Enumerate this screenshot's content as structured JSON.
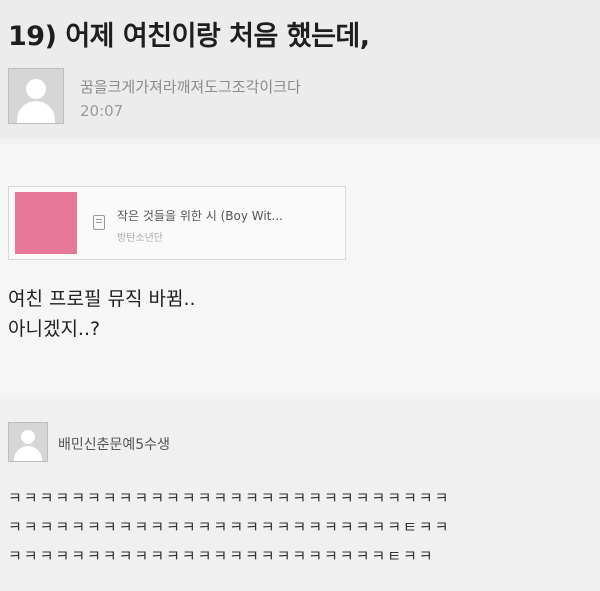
{
  "post": {
    "title": "19) 어제 여친이랑 처음 했는데,",
    "author": "꿈을크게가져라깨져도그조각이크다",
    "time": "20:07",
    "music": {
      "title": "작은 것들을 위한 시 (Boy Wit...",
      "artist": "방탄소년단",
      "album_color": "#e8789a"
    },
    "body_lines": [
      "여친 프로필 뮤직 바뀜..",
      "아니겠지..?"
    ]
  },
  "comment": {
    "author": "배민신춘문예5수생",
    "lines": [
      "ㅋㅋㅋㅋㅋㅋㅋㅋㅋㅋㅋㅋㅋㅋㅋㅋㅋㅋㅋㅋㅋㅋㅋㅋㅋㅋㅋㅋ",
      "ㅋㅋㅋㅋㅋㅋㅋㅋㅋㅋㅋㅋㅋㅋㅋㅋㅋㅋㅋㅋㅋㅋㅋㅋㅋㅌㅋㅋ",
      "ㅋㅋㅋㅋㅋㅋㅋㅋㅋㅋㅋㅋㅋㅋㅋㅋㅋㅋㅋㅋㅋㅋㅋㅋㅌㅋㅋ"
    ]
  }
}
